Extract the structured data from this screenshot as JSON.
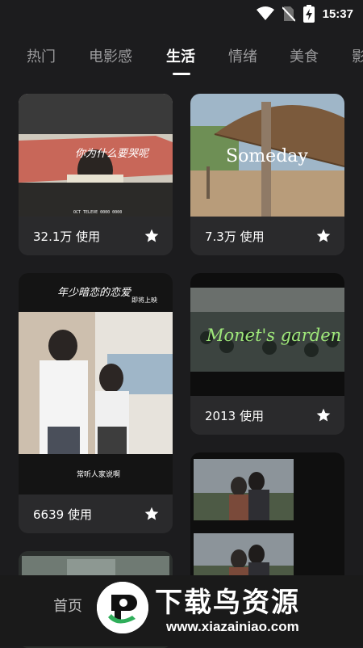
{
  "status_bar": {
    "time": "15:37",
    "icons": [
      "wifi-icon",
      "no-sim-icon",
      "battery-charging-icon"
    ]
  },
  "tabs": [
    {
      "label": "热门",
      "active": false
    },
    {
      "label": "电影感",
      "active": false
    },
    {
      "label": "生活",
      "active": true
    },
    {
      "label": "情绪",
      "active": false
    },
    {
      "label": "美食",
      "active": false
    },
    {
      "label": "影",
      "active": false
    }
  ],
  "cards": [
    {
      "usage": "32.1万 使用",
      "thumb_text": "你为什么要哭呢",
      "thumb_caption": "OCT TELEVE 0000 0000"
    },
    {
      "usage": "7.3万 使用",
      "thumb_text": "Someday"
    },
    {
      "usage": "6639 使用",
      "thumb_text": "年少暗恋的恋爱",
      "thumb_caption": "常听人家说啊",
      "thumb_tag": "即将上映"
    },
    {
      "usage": "2013 使用",
      "thumb_text": "Monet's garden"
    },
    {
      "usage": ""
    },
    {
      "usage": ""
    }
  ],
  "bottom_nav": {
    "home_label": "首页"
  },
  "watermark": {
    "title": "下载鸟资源",
    "url": "www.xiazainiao.com"
  },
  "colors": {
    "background": "#1c1c1e",
    "card": "#2a2a2c",
    "active_tab": "#ffffff",
    "inactive_tab": "#9a9a9c",
    "accent_green": "#2fae5a"
  }
}
